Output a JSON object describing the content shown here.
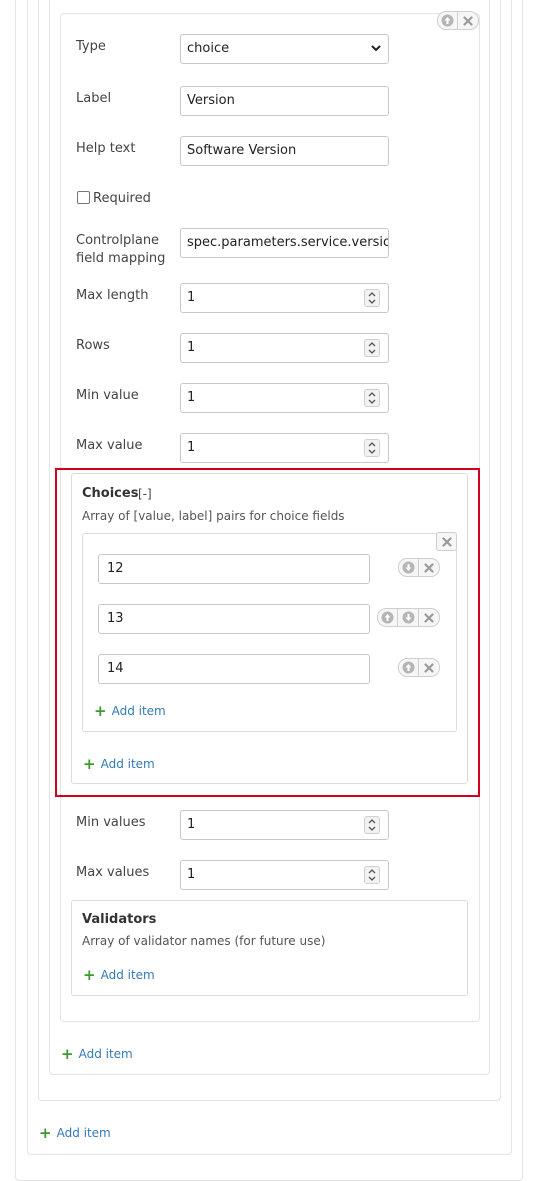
{
  "fields": {
    "type": {
      "label": "Type",
      "value": "choice"
    },
    "label": {
      "label": "Label",
      "value": "Version"
    },
    "help_text": {
      "label": "Help text",
      "value": "Software Version"
    },
    "required": {
      "label": "Required",
      "checked": false
    },
    "controlplane": {
      "label_line1": "Controlplane",
      "label_line2": "field mapping",
      "value": "spec.parameters.service.version"
    },
    "max_length": {
      "label": "Max length",
      "value": "1"
    },
    "rows": {
      "label": "Rows",
      "value": "1"
    },
    "min_value": {
      "label": "Min value",
      "value": "1"
    },
    "max_value": {
      "label": "Max value",
      "value": "1"
    },
    "min_values": {
      "label": "Min values",
      "value": "1"
    },
    "max_values": {
      "label": "Max values",
      "value": "1"
    }
  },
  "choices": {
    "title": "Choices",
    "toggle": "[-]",
    "description": "Array of [value, label] pairs for choice fields",
    "items": [
      "12",
      "13",
      "14"
    ],
    "inner_add_label": "Add item",
    "outer_add_label": "Add item"
  },
  "validators": {
    "title": "Validators",
    "description": "Array of validator names (for future use)",
    "add_label": "Add item"
  },
  "add_items": {
    "level3": "Add item",
    "level1": "Add item"
  },
  "colors": {
    "highlight": "#d0021b",
    "link": "#337ab7",
    "plus": "#3c9a2f"
  }
}
